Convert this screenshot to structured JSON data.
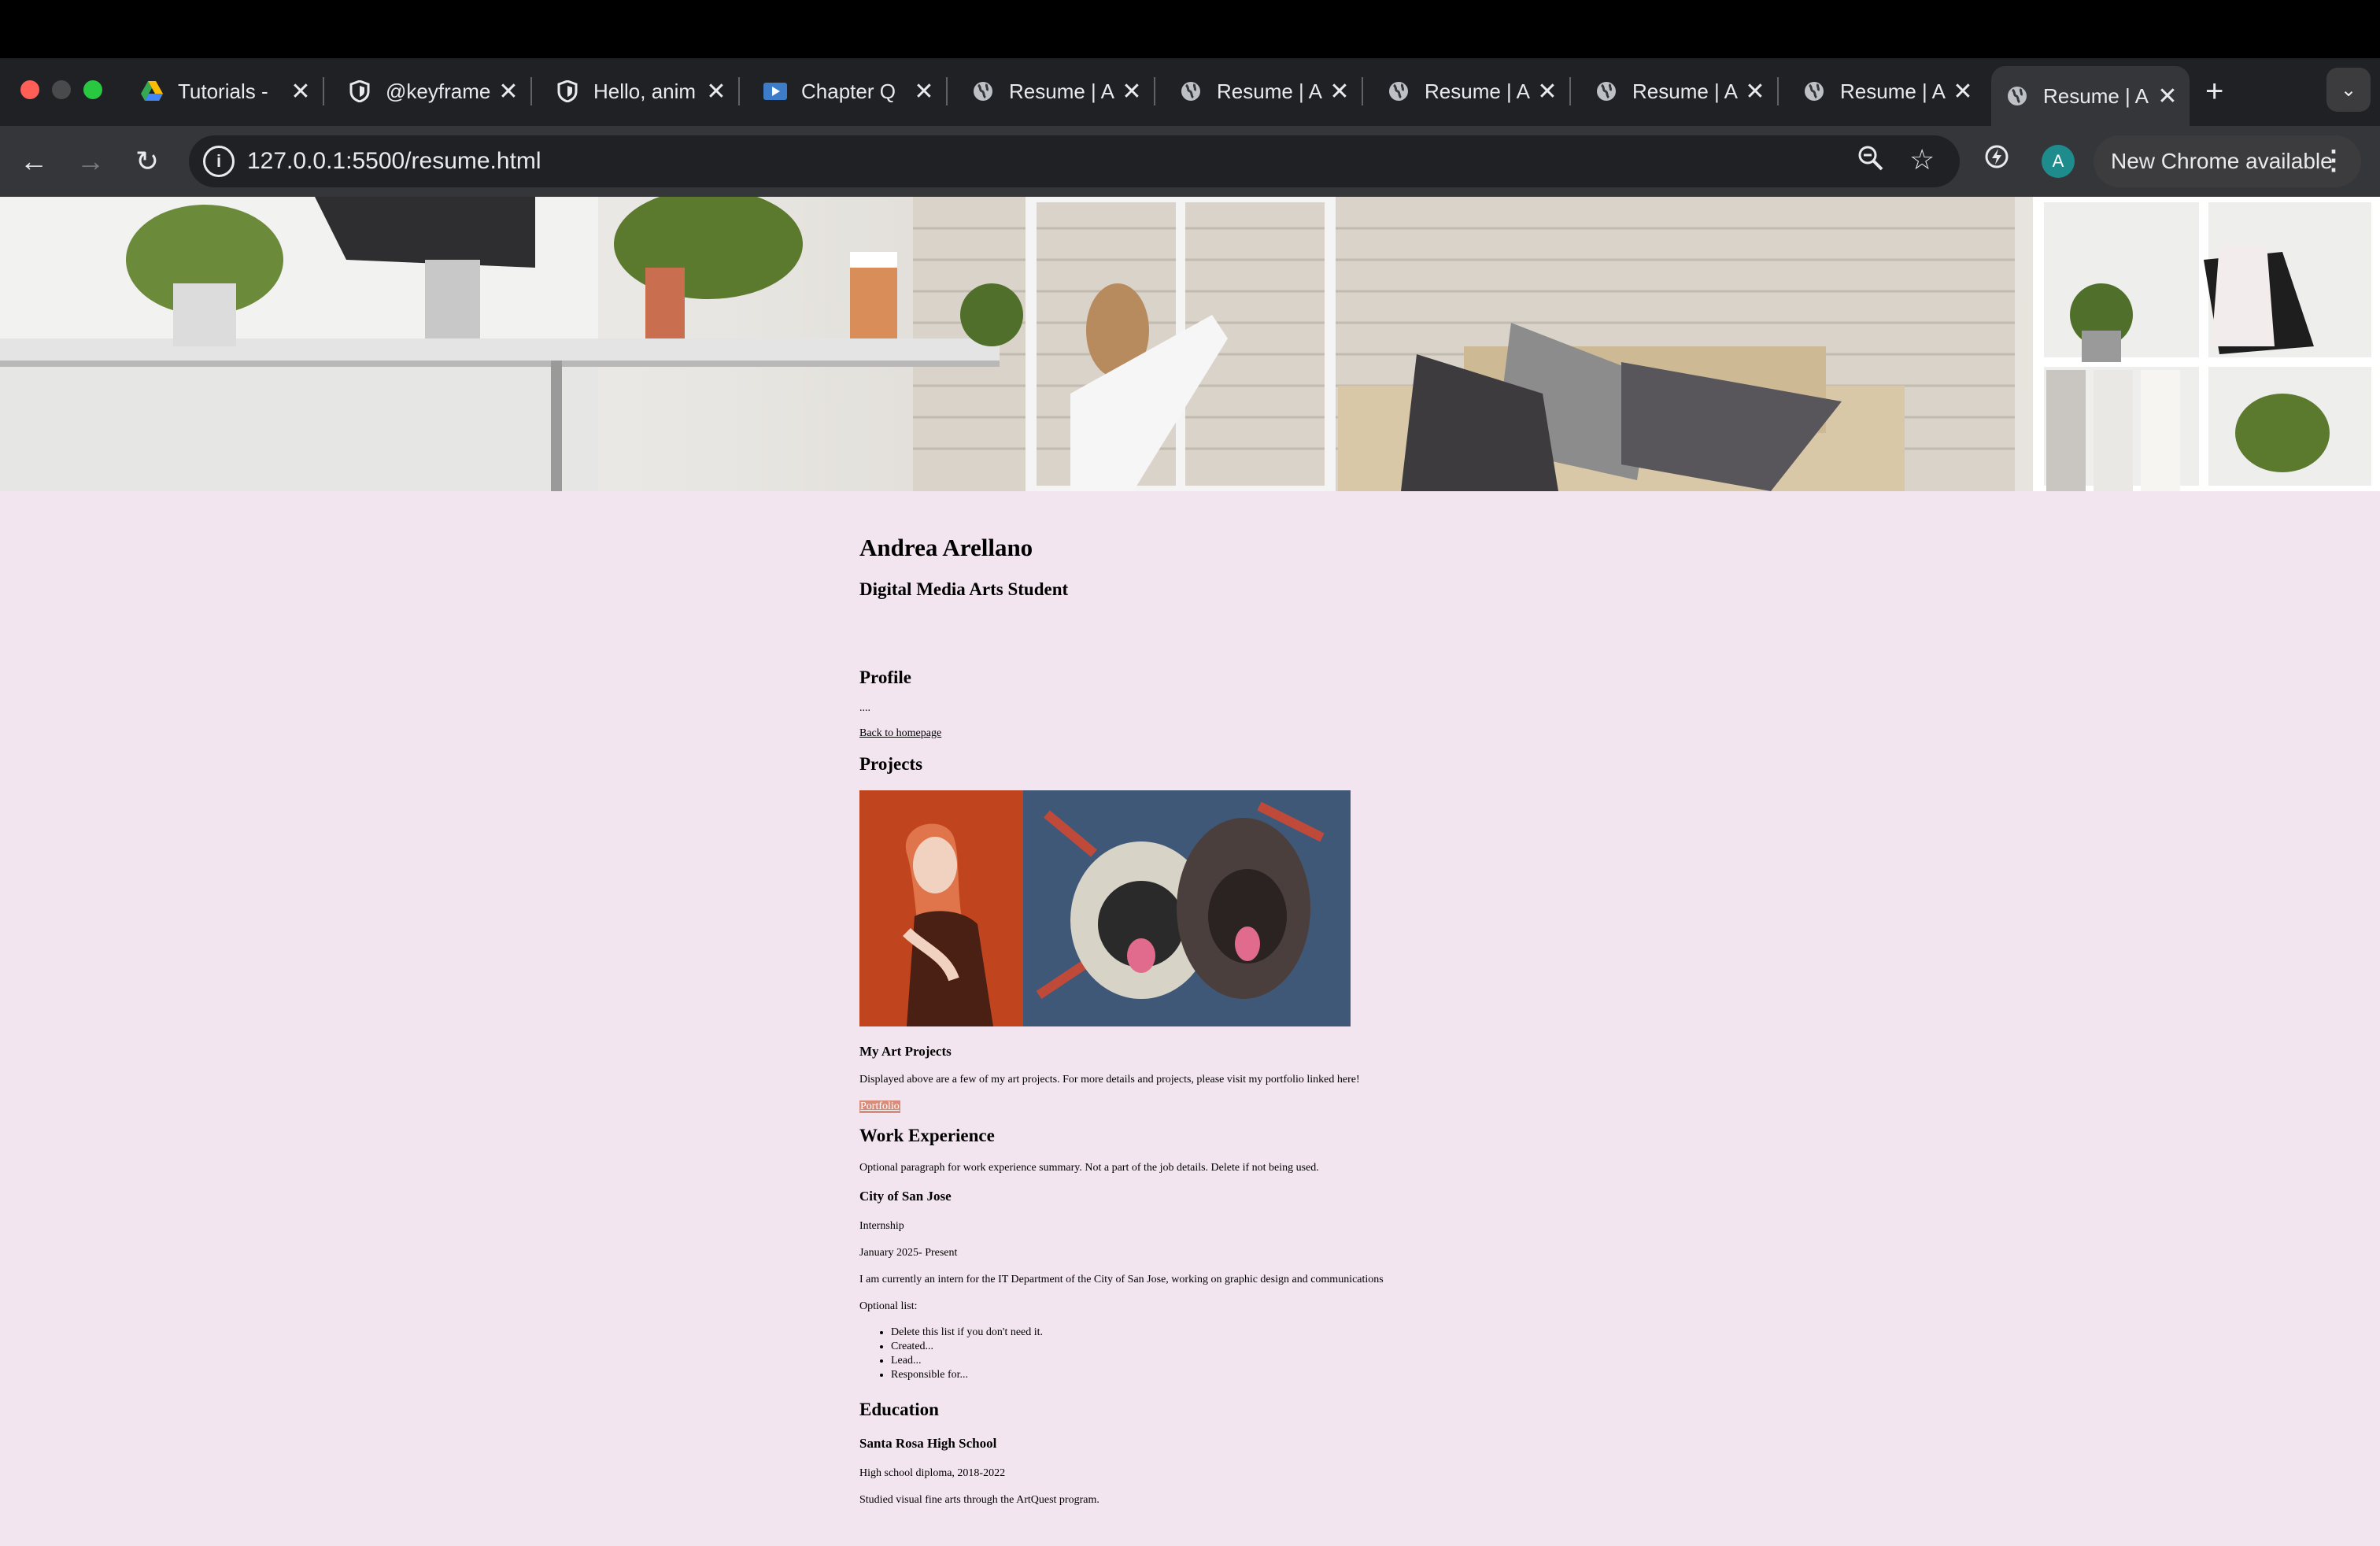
{
  "browser": {
    "tabs": [
      {
        "title": "Tutorials -",
        "icon": "google-drive-icon"
      },
      {
        "title": "@keyframe",
        "icon": "shield-icon"
      },
      {
        "title": "Hello, anim",
        "icon": "shield-icon"
      },
      {
        "title": "Chapter Q",
        "icon": "video-icon"
      },
      {
        "title": "Resume | A",
        "icon": "globe-icon"
      },
      {
        "title": "Resume | A",
        "icon": "globe-icon"
      },
      {
        "title": "Resume | A",
        "icon": "globe-icon"
      },
      {
        "title": "Resume | A",
        "icon": "globe-icon"
      },
      {
        "title": "Resume | A",
        "icon": "globe-icon"
      },
      {
        "title": "Resume | A",
        "icon": "globe-icon",
        "active": true
      }
    ],
    "url": "127.0.0.1:5500/resume.html",
    "avatar_letter": "A",
    "update_label": "New Chrome available"
  },
  "page": {
    "name": "Andrea Arellano",
    "subtitle": "Digital Media Arts Student",
    "profile": {
      "heading": "Profile",
      "text": "....",
      "back_link": "Back to homepage"
    },
    "projects": {
      "heading": "Projects",
      "subheading": "My Art Projects",
      "text": "Displayed above are a few of my art projects. For more details and projects, please visit my portfolio linked here!",
      "portfolio_link": "Portfolio"
    },
    "work": {
      "heading": "Work Experience",
      "summary": "Optional paragraph for work experience summary. Not a part of the job details. Delete if not being used.",
      "employer": "City of San Jose",
      "role": "Internship",
      "dates": "January 2025- Present",
      "description": "I am currently an intern for the IT Department of the City of San Jose, working on graphic design and communications",
      "list_label": "Optional list:",
      "list": [
        "Delete this list if you don't need it.",
        "Created...",
        "Lead...",
        "Responsible for..."
      ]
    },
    "education": {
      "heading": "Education",
      "school": "Santa Rosa High School",
      "diploma": "High school diploma, 2018-2022",
      "note": "Studied visual fine arts through the ArtQuest program."
    }
  },
  "colors": {
    "page_bg": "#f3e5ef",
    "tab_bg": "#202124",
    "toolbar_bg": "#35363a",
    "portfolio_highlight": "#d98c7a"
  }
}
